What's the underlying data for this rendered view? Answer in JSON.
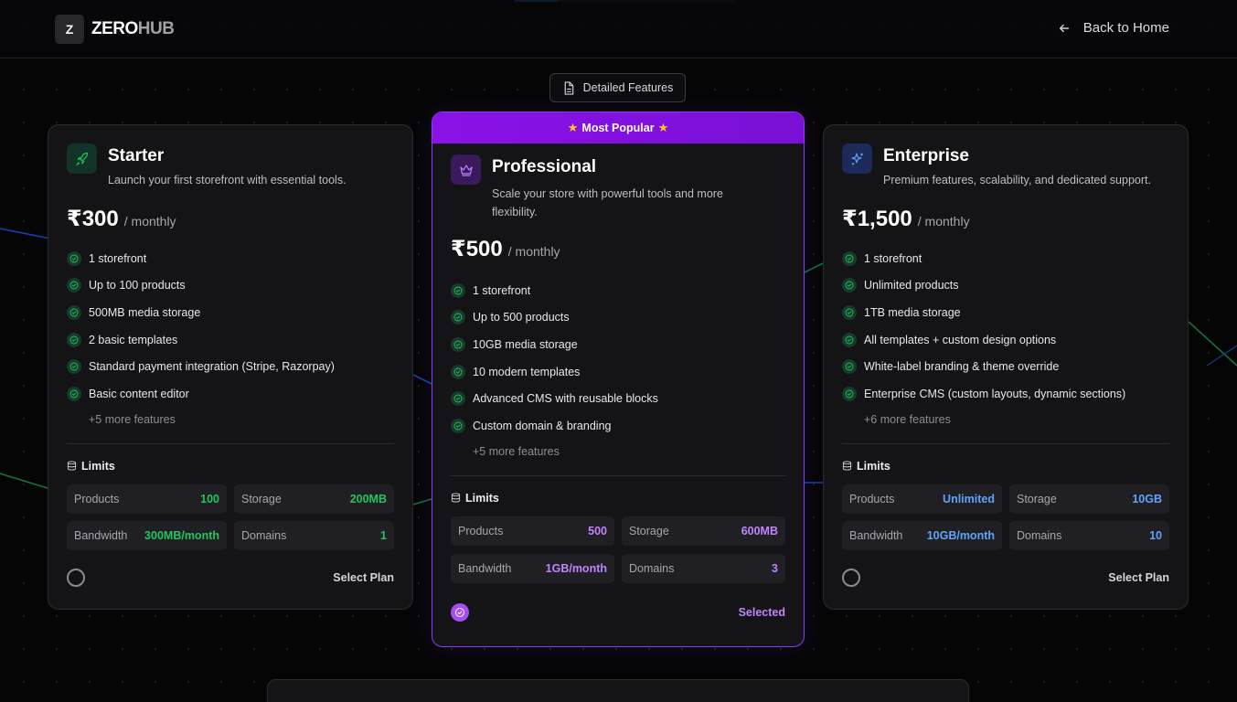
{
  "brand": {
    "mark": "Z",
    "name_a": "ZERO",
    "name_b": "HUB"
  },
  "nav": {
    "back_label": "Back to Home"
  },
  "detailed_features_label": "Detailed Features",
  "popular_badge": "Most Popular",
  "plans": [
    {
      "name": "Starter",
      "description": "Launch your first storefront with essential tools.",
      "price": "₹300",
      "period": "/ monthly",
      "features": [
        "1 storefront",
        "Up to 100 products",
        "500MB media storage",
        "2 basic templates",
        "Standard payment integration (Stripe, Razorpay)",
        "Basic content editor"
      ],
      "more": "+5 more features",
      "limits_title": "Limits",
      "limits": [
        {
          "label": "Products",
          "value": "100"
        },
        {
          "label": "Storage",
          "value": "200MB"
        },
        {
          "label": "Bandwidth",
          "value": "300MB/month"
        },
        {
          "label": "Domains",
          "value": "1"
        }
      ],
      "action": "Select Plan",
      "selected": false,
      "icon": "rocket-icon",
      "accent": "#22c55e"
    },
    {
      "name": "Professional",
      "description": "Scale your store with powerful tools and more flexibility.",
      "price": "₹500",
      "period": "/ monthly",
      "features": [
        "1 storefront",
        "Up to 500 products",
        "10GB media storage",
        "10 modern templates",
        "Advanced CMS with reusable blocks",
        "Custom domain & branding"
      ],
      "more": "+5 more features",
      "limits_title": "Limits",
      "limits": [
        {
          "label": "Products",
          "value": "500"
        },
        {
          "label": "Storage",
          "value": "600MB"
        },
        {
          "label": "Bandwidth",
          "value": "1GB/month"
        },
        {
          "label": "Domains",
          "value": "3"
        }
      ],
      "action": "Selected",
      "selected": true,
      "icon": "crown-icon",
      "accent": "#c084fc"
    },
    {
      "name": "Enterprise",
      "description": "Premium features, scalability, and dedicated support.",
      "price": "₹1,500",
      "period": "/ monthly",
      "features": [
        "1 storefront",
        "Unlimited products",
        "1TB media storage",
        "All templates + custom design options",
        "White-label branding & theme override",
        "Enterprise CMS (custom layouts, dynamic sections)"
      ],
      "more": "+6 more features",
      "limits_title": "Limits",
      "limits": [
        {
          "label": "Products",
          "value": "Unlimited"
        },
        {
          "label": "Storage",
          "value": "10GB"
        },
        {
          "label": "Bandwidth",
          "value": "10GB/month"
        },
        {
          "label": "Domains",
          "value": "10"
        }
      ],
      "action": "Select Plan",
      "selected": false,
      "icon": "sparkles-icon",
      "accent": "#60a5fa"
    }
  ]
}
